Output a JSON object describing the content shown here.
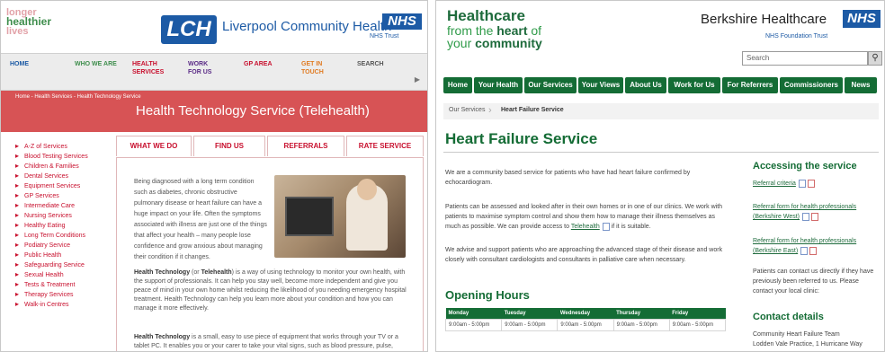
{
  "left": {
    "tagline": [
      "longer",
      "healthier",
      "lives"
    ],
    "logo": "LCH",
    "org_name": "Liverpool Community Health",
    "nhs": "NHS",
    "trust": "NHS Trust",
    "nav": [
      {
        "label": "HOME",
        "color": "#1c5aa5"
      },
      {
        "label": "WHO WE ARE",
        "color": "#3f8e4d"
      },
      {
        "label": "HEALTH SERVICES",
        "color": "#c8102e"
      },
      {
        "label": "WORK FOR US",
        "color": "#5a2b86"
      },
      {
        "label": "GP AREA",
        "color": "#c8102e"
      },
      {
        "label": "GET IN TOUCH",
        "color": "#e07b22"
      },
      {
        "label": "SEARCH",
        "color": "#555555"
      }
    ],
    "breadcrumb": "Home - Health Services - Health Technology Service",
    "band_title": "Health Technology Service (Telehealth)",
    "sidebar": [
      "A-Z of Services",
      "Blood Testing Services",
      "Children & Families",
      "Dental Services",
      "Equipment Services",
      "GP Services",
      "Intermediate Care",
      "Nursing Services",
      "Healthy Eating",
      "Long Term Conditions",
      "Podiatry Service",
      "Public Health",
      "Safeguarding Service",
      "Sexual Health",
      "Tests & Treatment",
      "Therapy Services",
      "Walk-in Centres"
    ],
    "tabs": [
      "WHAT WE DO",
      "FIND US",
      "REFERRALS",
      "RATE SERVICE"
    ],
    "intro": "Being diagnosed with a long term condition such as diabetes, chronic obstructive pulmonary disease or heart failure can have a huge impact on your life. Often the symptoms associated with illness are just one of the things that affect your health – many people lose confidence and grow anxious about managing their condition if it changes.",
    "para1_bold": "Health Technology",
    "para1_mid": " (or ",
    "para1_bold2": "Telehealth",
    "para1_rest": ") is a way of using technology to monitor your own health, with the support of professionals. It can help you stay well, become more independent and give you peace of mind in your own home whilst reducing the likelihood of you needing emergency hospital treatment. Health Technology can help you learn more about your condition and how you can manage it more effectively.",
    "para2_bold": "Health Technology",
    "para2_rest": " is a small, easy to use piece of equipment that works through your TV or a tablet PC. It enables you or your carer to take your vital signs, such as blood pressure, pulse,"
  },
  "right": {
    "brand": {
      "line1": "Healthcare",
      "line2a": "from the ",
      "line2b": "heart",
      "line2c": " of",
      "line3a": "your ",
      "line3b": "community"
    },
    "org_name": "Berkshire Healthcare",
    "nhs": "NHS",
    "trust": "NHS Foundation Trust",
    "search_placeholder": "Search",
    "search_icon": "magnifier-icon",
    "nav": [
      "Home",
      "Your Health",
      "Our Services",
      "Your Views",
      "About Us",
      "Work for Us",
      "For Referrers",
      "Commissioners",
      "News"
    ],
    "breadcrumb": [
      "Our Services",
      "Heart Failure Service"
    ],
    "title": "Heart Failure Service",
    "p1": "We are a community based service for patients who have had heart failure confirmed by echocardiogram.",
    "p2a": "Patients can be assessed and looked after in their own homes or in one of our clinics.  We work with patients to maximise symptom control and show them how to manage their illness themselves as much as possible. We can provide access to ",
    "p2_link": "Telehealth",
    "p2b": " if it is suitable.",
    "p3": "We advise and support patients who are approaching the advanced stage of their disease and work closely with consultant cardiologists and consultants in palliative care when necessary.",
    "hours_title": "Opening Hours",
    "hours_headers": [
      "Monday",
      "Tuesday",
      "Wednesday",
      "Thursday",
      "Friday"
    ],
    "hours_values": [
      "9:00am - 5:00pm",
      "9:00am - 5:00pm",
      "9:00am - 5:00pm",
      "9:00am - 5:00pm",
      "9:00am - 5:00pm"
    ],
    "access_title": "Accessing the service",
    "links": [
      "Referral criteria",
      "Referral form for health professionals (Berkshire West)",
      "Referral form for health professionals (Berkshire East)"
    ],
    "contact_note": "Patients can contact us directly if they have previously been referred to us. Please contact your local clinic:",
    "contact_title": "Contact details",
    "contact_lines": [
      "Community Heart Failure Team",
      "Lodden Vale Practice, 1 Hurricane Way"
    ],
    "colors": {
      "green": "#146c35",
      "nhs_blue": "#1c5aa5"
    }
  }
}
